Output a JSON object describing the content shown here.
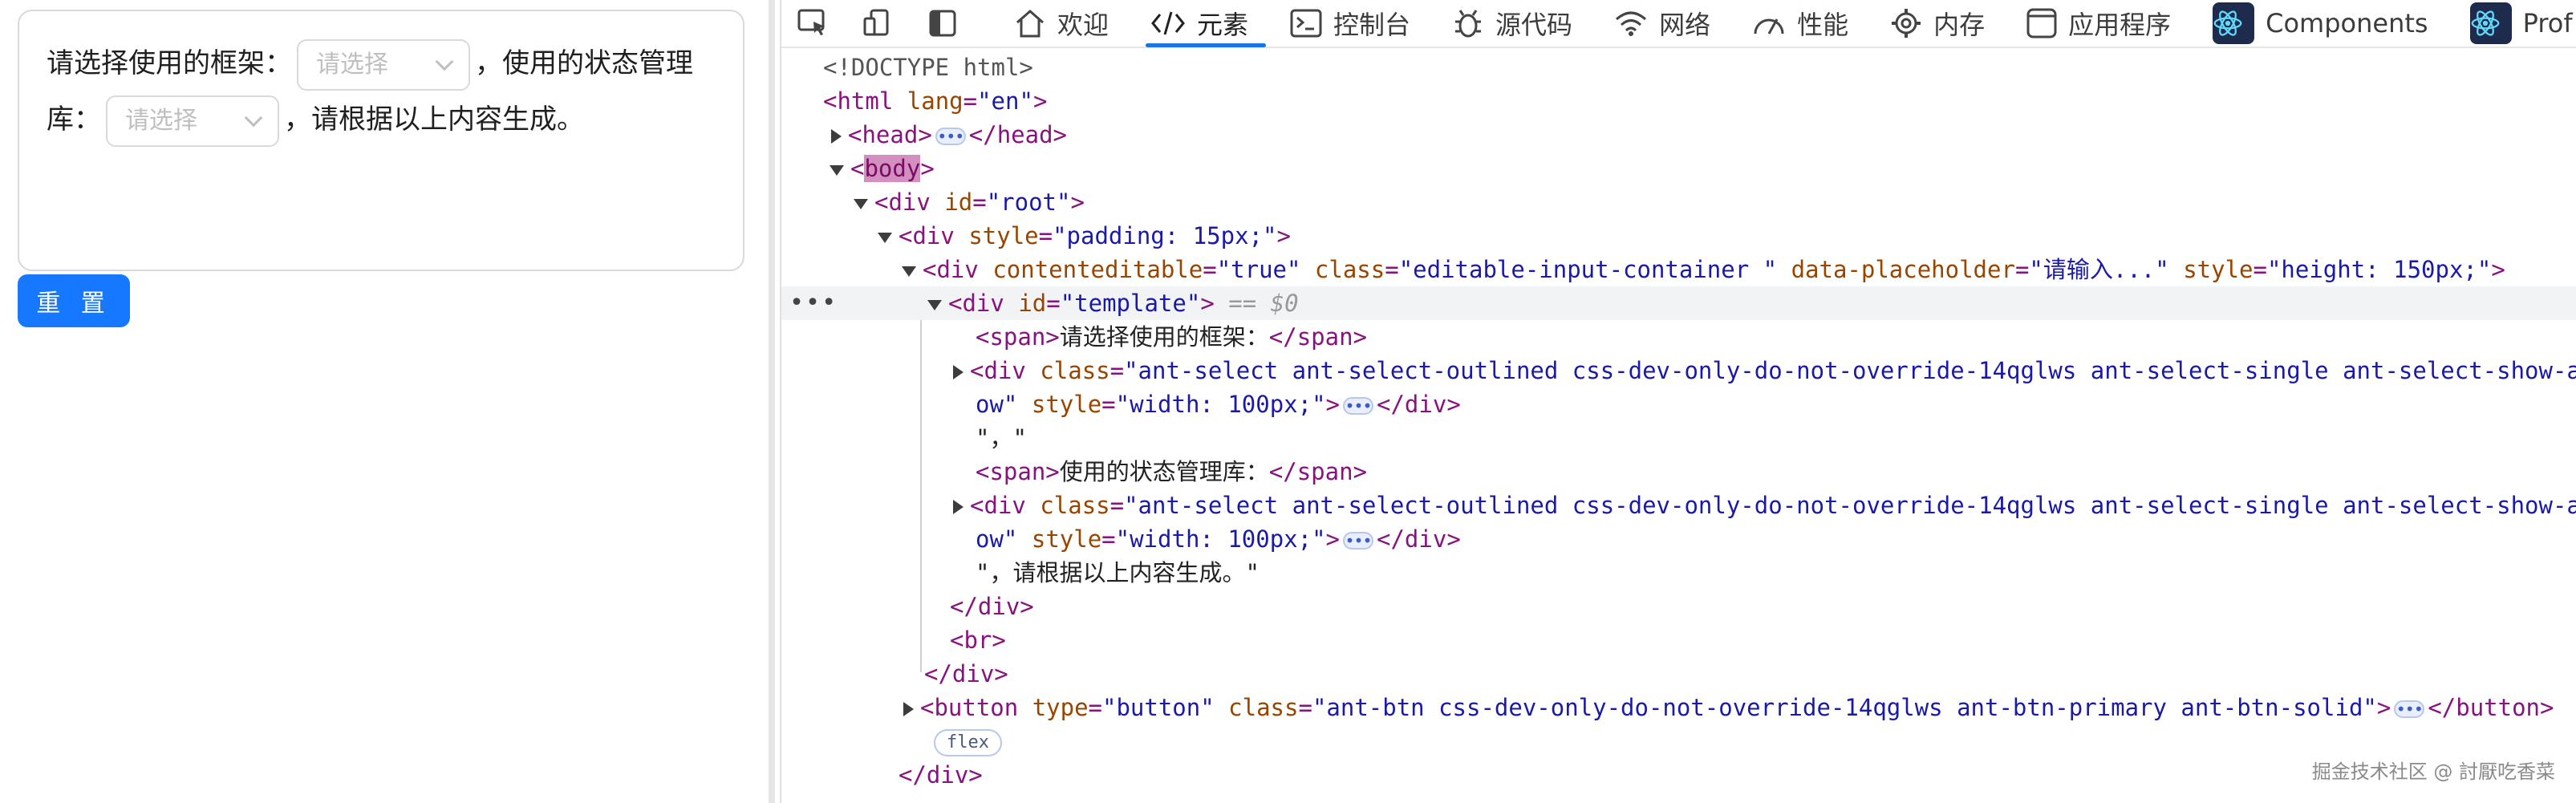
{
  "app": {
    "editor": {
      "text1": "请选择使用的框架：",
      "select1_placeholder": "请选择",
      "text2": "，使用的状态管理库：",
      "select2_placeholder": "请选择",
      "text3": "，请根据以上内容生成。"
    },
    "reset_button": "重 置"
  },
  "devtools": {
    "tabs": [
      {
        "label": "欢迎",
        "icon": "home-icon"
      },
      {
        "label": "元素",
        "icon": "code-icon",
        "active": true
      },
      {
        "label": "控制台",
        "icon": "console-icon"
      },
      {
        "label": "源代码",
        "icon": "bug-icon"
      },
      {
        "label": "网络",
        "icon": "wifi-icon"
      },
      {
        "label": "性能",
        "icon": "gauge-icon"
      },
      {
        "label": "内存",
        "icon": "gear-icon"
      },
      {
        "label": "应用程序",
        "icon": "app-window-icon"
      },
      {
        "label": "Components",
        "icon": "react-icon"
      },
      {
        "label": "Prof",
        "icon": "react-icon"
      }
    ],
    "tree": {
      "doctype": "<!DOCTYPE html>",
      "html_tag": "html",
      "html_attr": "lang",
      "html_val": "\"en\"",
      "head": "head",
      "body": "body",
      "root_div_attr": "id",
      "root_div_val": "\"root\"",
      "pad_div_attr": "style",
      "pad_div_val": "\"padding: 15px;\"",
      "ce_attr1": "contenteditable",
      "ce_val1": "\"true\"",
      "ce_attr2": "class",
      "ce_val2": "\"editable-input-container \"",
      "ce_attr3": "data-placeholder",
      "ce_val3": "\"请输入...\"",
      "ce_attr4": "style",
      "ce_val4": "\"height: 150px;\"",
      "tpl_attr": "id",
      "tpl_val": "\"template\"",
      "tpl_eq": "== $0",
      "span1": "请选择使用的框架：",
      "sel_class_attr": "class",
      "sel_class_val_a": "\"ant-select ant-select-outlined css-dev-only-do-not-override-14qglws ant-select-single ant-select-show-a",
      "sel_class_val_b": "ow\"",
      "sel_style_attr": "style",
      "sel_style_val": "\"width: 100px;\"",
      "comma_text": "\"，\"",
      "span2": "使用的状态管理库：",
      "final_text": "\"，请根据以上内容生成。\"",
      "br": "br",
      "btn_attr1": "type",
      "btn_val1": "\"button\"",
      "btn_attr2": "class",
      "btn_val2": "\"ant-btn css-dev-only-do-not-override-14qglws ant-btn-primary ant-btn-solid\"",
      "flex_badge": "flex"
    },
    "watermark": "掘金技术社区 @ 討厭吃香菜"
  }
}
